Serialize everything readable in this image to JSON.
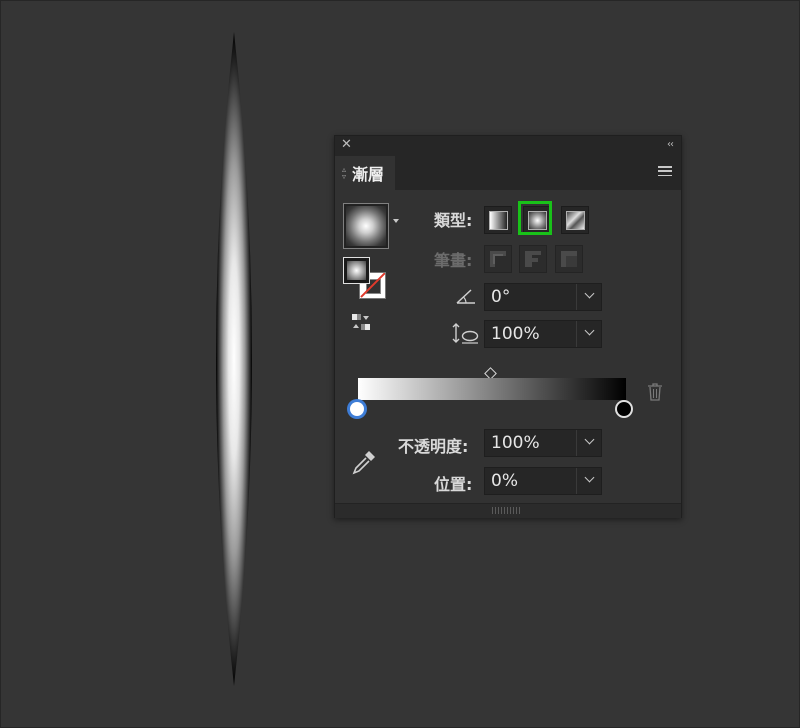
{
  "colors": {
    "background": "#353535",
    "panel": "#323232",
    "selected_outline": "#19c219"
  },
  "canvas_shape": {
    "type": "radial gradient ellipse",
    "start_color": "#ffffff",
    "end_color": "#000000"
  },
  "panel": {
    "close_icon": "close-icon",
    "collapse_icon": "collapse-arrows-icon",
    "tab_label": "漸層",
    "menu_icon": "hamburger-menu-icon",
    "type_label": "類型:",
    "type_options": [
      "linear-gradient",
      "radial-gradient",
      "freeform-gradient"
    ],
    "type_selected": "radial-gradient",
    "stroke_label": "筆畫:",
    "angle_value": "0°",
    "aspect_value": "100%",
    "opacity_label": "不透明度:",
    "opacity_value": "100%",
    "location_label": "位置:",
    "location_value": "0%",
    "gradient_stops": [
      {
        "color": "#ffffff",
        "location": 0,
        "selected": true
      },
      {
        "color": "#000000",
        "location": 100,
        "selected": false
      }
    ],
    "midpoint": 50
  }
}
